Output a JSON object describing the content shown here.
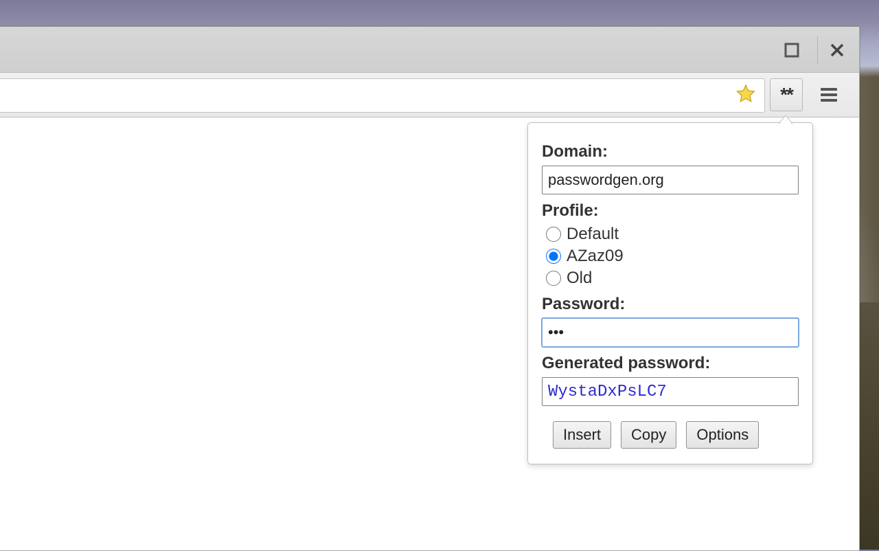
{
  "extension_button_glyph": "**",
  "popup": {
    "domain_label": "Domain:",
    "domain_value": "passwordgen.org",
    "profile_label": "Profile:",
    "profiles": [
      {
        "label": "Default",
        "selected": false
      },
      {
        "label": "AZaz09",
        "selected": true
      },
      {
        "label": "Old",
        "selected": false
      }
    ],
    "password_label": "Password:",
    "password_mask": "•••",
    "generated_label": "Generated password:",
    "generated_value": "WystaDxPsLC7",
    "buttons": {
      "insert": "Insert",
      "copy": "Copy",
      "options": "Options"
    }
  }
}
